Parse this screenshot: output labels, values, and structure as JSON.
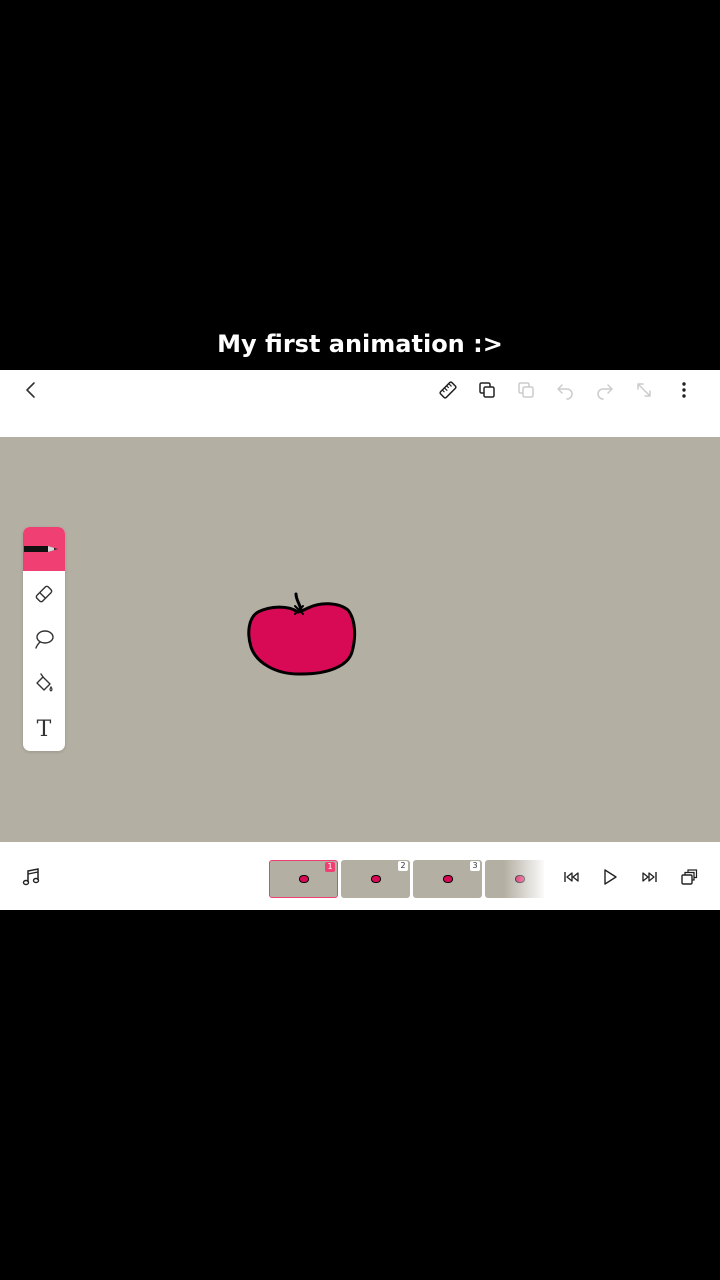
{
  "caption": "My first animation :>",
  "topbar": {
    "icons": [
      "back-icon",
      "ruler-icon",
      "copy-icon",
      "paste-icon",
      "undo-icon",
      "redo-icon",
      "resize-icon",
      "more-icon"
    ]
  },
  "toolbox": {
    "tools": [
      "pen",
      "eraser",
      "lasso",
      "fill",
      "text"
    ],
    "active": "pen",
    "text_tool_glyph": "T"
  },
  "drawing": {
    "subject": "apple",
    "fill_color": "#d80a55",
    "outline_color": "#000000"
  },
  "canvas_color": "#b4afa3",
  "accent_color": "#ef3f73",
  "timeline": {
    "frames": [
      {
        "number": "1",
        "selected": true
      },
      {
        "number": "2",
        "selected": false
      },
      {
        "number": "3",
        "selected": false
      },
      {
        "number": "",
        "selected": false
      }
    ]
  },
  "bottombar": {
    "icons": [
      "music-icon",
      "skip-start-icon",
      "play-icon",
      "skip-end-icon",
      "frames-stack-icon"
    ]
  }
}
